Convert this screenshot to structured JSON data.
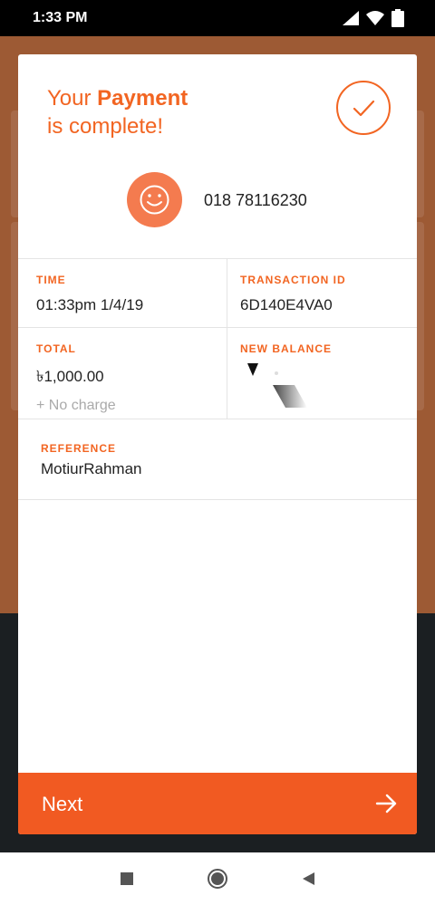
{
  "status_bar": {
    "time": "1:33 PM",
    "battery": "73"
  },
  "payment": {
    "heading_line1_prefix": "Your ",
    "heading_line1_bold": "Payment",
    "heading_line2": "is complete!",
    "phone": "018 78116230"
  },
  "details": {
    "time_label": "TIME",
    "time_value": "01:33pm 1/4/19",
    "txn_label": "TRANSACTION ID",
    "txn_value": "6D140E4VA0",
    "total_label": "TOTAL",
    "total_value": "৳1,000.00",
    "total_sub": "+ No charge",
    "balance_label": "NEW BALANCE",
    "reference_label": "REFERENCE",
    "reference_value": "MotiurRahman"
  },
  "next_button": {
    "label": "Next"
  },
  "colors": {
    "accent": "#f26522",
    "button": "#f15a22"
  }
}
